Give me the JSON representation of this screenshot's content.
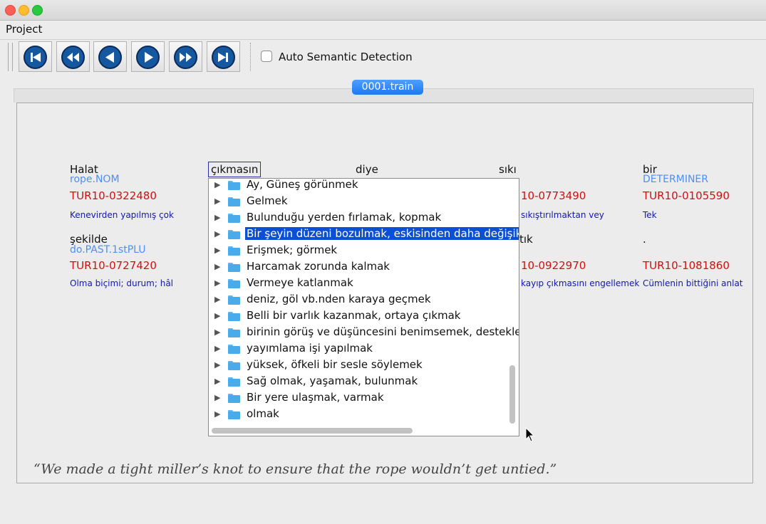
{
  "window": {
    "controls": [
      "close",
      "minimize",
      "zoom"
    ]
  },
  "menubar": {
    "items": [
      "Project"
    ]
  },
  "toolbar": {
    "buttons": [
      {
        "name": "first",
        "icon": "skip-to-start-icon"
      },
      {
        "name": "fast-backward",
        "icon": "fast-backward-icon"
      },
      {
        "name": "previous",
        "icon": "step-backward-icon"
      },
      {
        "name": "next",
        "icon": "play-icon"
      },
      {
        "name": "fast-forward",
        "icon": "fast-forward-icon"
      },
      {
        "name": "last",
        "icon": "skip-to-end-icon"
      }
    ],
    "checkbox_label": "Auto Semantic Detection",
    "checkbox_checked": false
  },
  "tab": {
    "label": "0001.train"
  },
  "words": [
    {
      "word": "Halat",
      "morph": "rope.NOM",
      "sense": "TUR10-0322480",
      "gloss": "Kenevirden yapılmış çok"
    },
    {
      "word": "çıkmasın",
      "morph": "",
      "sense": "",
      "gloss": ""
    },
    {
      "word": "diye",
      "morph": "",
      "sense": "",
      "gloss": ""
    },
    {
      "word": "sıkı",
      "morph": "",
      "sense": "10-0773490",
      "gloss": "sıkıştırılmaktan vey"
    },
    {
      "word": "bir",
      "morph": "DETERMINER",
      "sense": "TUR10-0105590",
      "gloss": "Tek"
    },
    {
      "word": "şekilde",
      "morph": "do.PAST.1stPLU",
      "sense": "TUR10-0727420",
      "gloss": "Olma biçimi; durum; hâl"
    },
    {
      "word": "tık",
      "morph": "",
      "sense": "10-0922970",
      "gloss": "kayıp çıkmasını engellemek"
    },
    {
      "word": ".",
      "morph": "",
      "sense": "TUR10-1081860",
      "gloss": "Cümlenin bittiğini anlat"
    }
  ],
  "dropdown": {
    "selected_index": 3,
    "items": [
      "Ay, Güneş görünmek",
      "Gelmek",
      "Bulunduğu yerden fırlamak, kopmak",
      "Bir şeyin düzeni bozulmak, eskisinden daha değişik,",
      "Erişmek; görmek",
      "Harcamak zorunda kalmak",
      "Vermeye katlanmak",
      "deniz, göl vb.nden karaya geçmek",
      "Belli bir varlık kazanmak, ortaya çıkmak",
      "birinin görüş ve düşüncesini benimsemek, desteklen",
      "yayımlama işi yapılmak",
      "yüksek, öfkeli bir sesle söylemek",
      "Sağ olmak, yaşamak, bulunmak",
      "Bir yere ulaşmak, varmak",
      "olmak"
    ]
  },
  "caption": "“We made a tight miller’s knot to ensure that the rope wouldn’t get untied.”",
  "colors": {
    "accent": "#1c78f2",
    "sense_id": "#d01010",
    "gloss": "#1515b8",
    "morph": "#4d8ff5",
    "selection": "#0a4fd4"
  }
}
